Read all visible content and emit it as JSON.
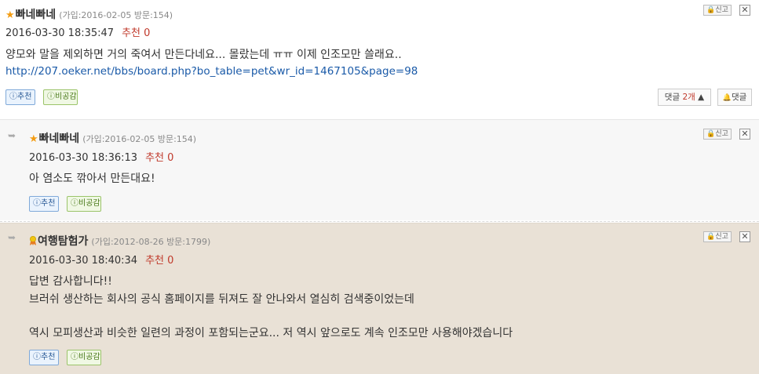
{
  "icons": {
    "star": "★",
    "arrow": "➥",
    "report_lock": "🔒",
    "close": "✕",
    "like": "ⓘ",
    "dislike": "ⓘ",
    "reply": "🔔"
  },
  "colors": {
    "recommend_count": "#c0392b",
    "link": "#1a5aa8",
    "highlight_bg": "#e9e1d6"
  },
  "comments": [
    {
      "author": "빠네빠네",
      "meta": "(가입:2016-02-05 방문:154)",
      "date": "2016-03-30 18:35:47",
      "recommend_label": "추천",
      "recommend_count": "0",
      "lines": [
        "양모와 말을 제외하면 거의 죽여서 만든다네요... 몰랐는데 ㅠㅠ 이제 인조모만 쓸래요.."
      ],
      "link": "http://207.oeker.net/bbs/board.php?bo_table=pet&wr_id=1467105&page=98",
      "like_label": "추천",
      "dislike_label": "비공감",
      "report_label": "신고",
      "comment_toggle_prefix": "댓글 ",
      "comment_toggle_count": "2개",
      "comment_toggle_arrow": "▲",
      "reply_label": "댓글"
    },
    {
      "author": "빠네빠네",
      "meta": "(가입:2016-02-05 방문:154)",
      "date": "2016-03-30 18:36:13",
      "recommend_label": "추천",
      "recommend_count": "0",
      "lines": [
        "아 염소도 깎아서 만든대요!"
      ],
      "like_label": "추천",
      "dislike_label": "비공감",
      "report_label": "신고"
    },
    {
      "author": "여행탐험가",
      "meta": "(가입:2012-08-26 방문:1799)",
      "date": "2016-03-30 18:40:34",
      "recommend_label": "추천",
      "recommend_count": "0",
      "lines": [
        "답변 감사합니다!!",
        "브러쉬 생산하는 회사의 공식 홈페이지를 뒤져도 잘 안나와서 열심히 검색중이었는데",
        "역시 모피생산과 비슷한 일련의 과정이 포함되는군요... 저 역시 앞으로도 계속 인조모만 사용해야겠습니다"
      ],
      "like_label": "추천",
      "dislike_label": "비공감",
      "report_label": "신고"
    }
  ]
}
